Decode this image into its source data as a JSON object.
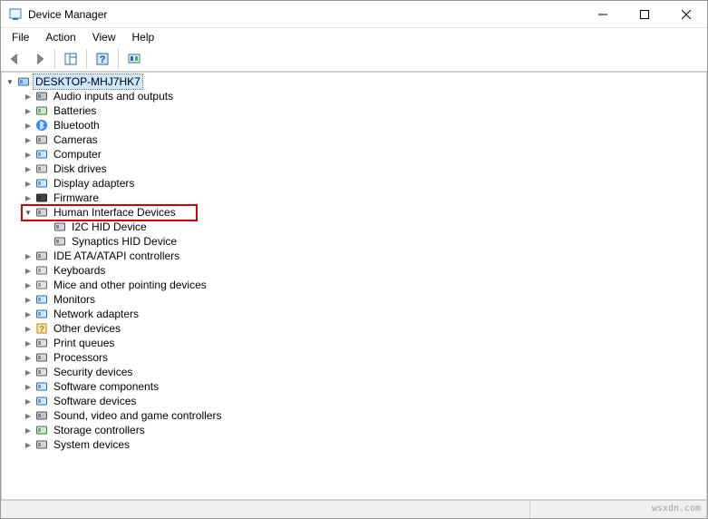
{
  "window": {
    "title": "Device Manager"
  },
  "menubar": {
    "file": "File",
    "action": "Action",
    "view": "View",
    "help": "Help"
  },
  "tree": {
    "root": {
      "label": "DESKTOP-MHJ7HK7",
      "expanded": true
    },
    "nodes": [
      {
        "label": "Audio inputs and outputs",
        "icon": "audio-icon",
        "expanded": false
      },
      {
        "label": "Batteries",
        "icon": "battery-icon",
        "expanded": false
      },
      {
        "label": "Bluetooth",
        "icon": "bluetooth-icon",
        "expanded": false
      },
      {
        "label": "Cameras",
        "icon": "camera-icon",
        "expanded": false
      },
      {
        "label": "Computer",
        "icon": "computer-icon",
        "expanded": false
      },
      {
        "label": "Disk drives",
        "icon": "disk-icon",
        "expanded": false
      },
      {
        "label": "Display adapters",
        "icon": "display-icon",
        "expanded": false
      },
      {
        "label": "Firmware",
        "icon": "firmware-icon",
        "expanded": false
      },
      {
        "label": "Human Interface Devices",
        "icon": "hid-icon",
        "expanded": true,
        "highlighted": true,
        "children": [
          {
            "label": "I2C HID Device",
            "icon": "hid-icon"
          },
          {
            "label": "Synaptics HID Device",
            "icon": "hid-icon"
          }
        ]
      },
      {
        "label": "IDE ATA/ATAPI controllers",
        "icon": "ide-icon",
        "expanded": false
      },
      {
        "label": "Keyboards",
        "icon": "keyboard-icon",
        "expanded": false
      },
      {
        "label": "Mice and other pointing devices",
        "icon": "mouse-icon",
        "expanded": false
      },
      {
        "label": "Monitors",
        "icon": "monitor-icon",
        "expanded": false
      },
      {
        "label": "Network adapters",
        "icon": "network-icon",
        "expanded": false
      },
      {
        "label": "Other devices",
        "icon": "other-icon",
        "expanded": false
      },
      {
        "label": "Print queues",
        "icon": "print-icon",
        "expanded": false
      },
      {
        "label": "Processors",
        "icon": "processor-icon",
        "expanded": false
      },
      {
        "label": "Security devices",
        "icon": "security-icon",
        "expanded": false
      },
      {
        "label": "Software components",
        "icon": "softcomp-icon",
        "expanded": false
      },
      {
        "label": "Software devices",
        "icon": "softdev-icon",
        "expanded": false
      },
      {
        "label": "Sound, video and game controllers",
        "icon": "sound-icon",
        "expanded": false
      },
      {
        "label": "Storage controllers",
        "icon": "storage-icon",
        "expanded": false
      },
      {
        "label": "System devices",
        "icon": "system-icon",
        "expanded": false
      }
    ]
  },
  "watermark": "wsxdn.com"
}
